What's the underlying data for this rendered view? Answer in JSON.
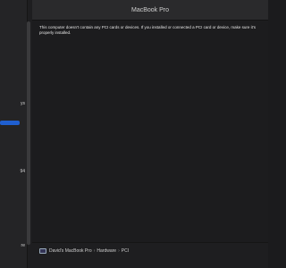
{
  "window": {
    "title": "MacBook Pro"
  },
  "sidebar": {
    "items": [
      {
        "label": "ys"
      },
      {
        "label": "94"
      },
      {
        "label": "re"
      }
    ]
  },
  "content": {
    "message": "This computer doesn’t contain any PCI cards or devices. If you installed or connected a PCI card or device, make sure it’s properly installed."
  },
  "pathbar": {
    "crumbs": [
      {
        "label": "David’s MacBook Pro"
      },
      {
        "label": "Hardware"
      },
      {
        "label": "PCI"
      }
    ],
    "separator": "›"
  }
}
